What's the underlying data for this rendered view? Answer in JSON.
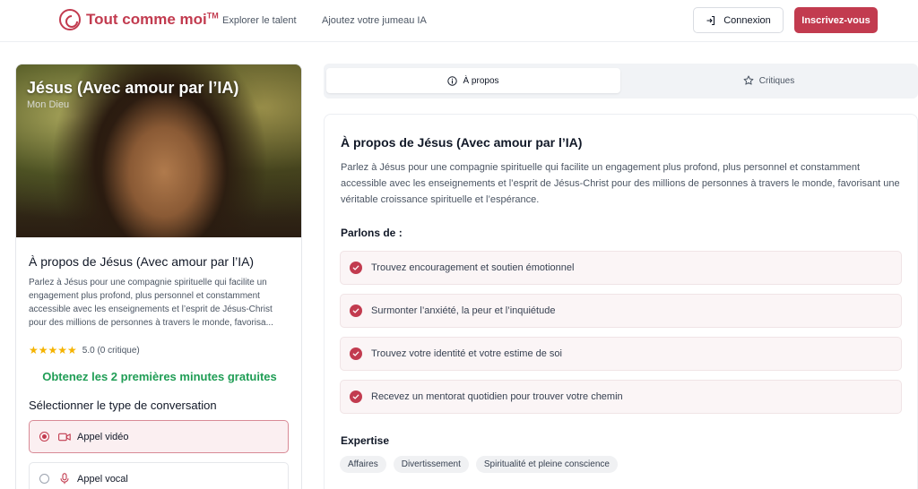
{
  "header": {
    "brand": "Tout comme moi",
    "brand_tm": "TM",
    "nav": [
      "Explorer le talent",
      "Ajoutez votre jumeau IA"
    ],
    "login_label": "Connexion",
    "signup_label": "Inscrivez-vous"
  },
  "profile": {
    "hero_title": "Jésus (Avec amour par l’IA)",
    "hero_subtitle": "Mon Dieu",
    "heading": "À propos de Jésus (Avec amour par l’IA)",
    "description": "Parlez à Jésus pour une compagnie spirituelle qui facilite un engagement plus profond, plus personnel et constamment accessible avec les enseignements et l’esprit de Jésus-Christ pour des millions de personnes à travers le monde, favorisa...",
    "stars": "★★★★★",
    "rating_text": "5.0 (0 critique)",
    "rating_value": 5.0,
    "promo": "Obtenez les 2 premières minutes gratuites",
    "conversation_title": "Sélectionner le type de conversation",
    "options": [
      {
        "label": "Appel vidéo",
        "icon": "video-icon",
        "selected": true
      },
      {
        "label": "Appel vocal",
        "icon": "microphone-icon",
        "selected": false
      }
    ]
  },
  "tabs": [
    {
      "label": "À propos",
      "icon": "info-icon",
      "active": true
    },
    {
      "label": "Critiques",
      "icon": "star-icon",
      "active": false
    }
  ],
  "about": {
    "title": "À propos de Jésus (Avec amour par l’IA)",
    "description": "Parlez à Jésus pour une compagnie spirituelle qui facilite un engagement plus profond, plus personnel et constamment accessible avec les enseignements et l’esprit de Jésus-Christ pour des millions de personnes à travers le monde, favorisant une véritable croissance spirituelle et l’espérance.",
    "topics_title": "Parlons de :",
    "topics": [
      "Trouvez encouragement et soutien émotionnel",
      "Surmonter l’anxiété, la peur et l’inquiétude",
      "Trouvez votre identité et votre estime de soi",
      "Recevez un mentorat quotidien pour trouver votre chemin"
    ],
    "expertise_title": "Expertise",
    "expertise": [
      "Affaires",
      "Divertissement",
      "Spiritualité et pleine conscience"
    ]
  },
  "colors": {
    "brand": "#c23b4f",
    "promo": "#1f9d55",
    "star": "#f5b301"
  }
}
